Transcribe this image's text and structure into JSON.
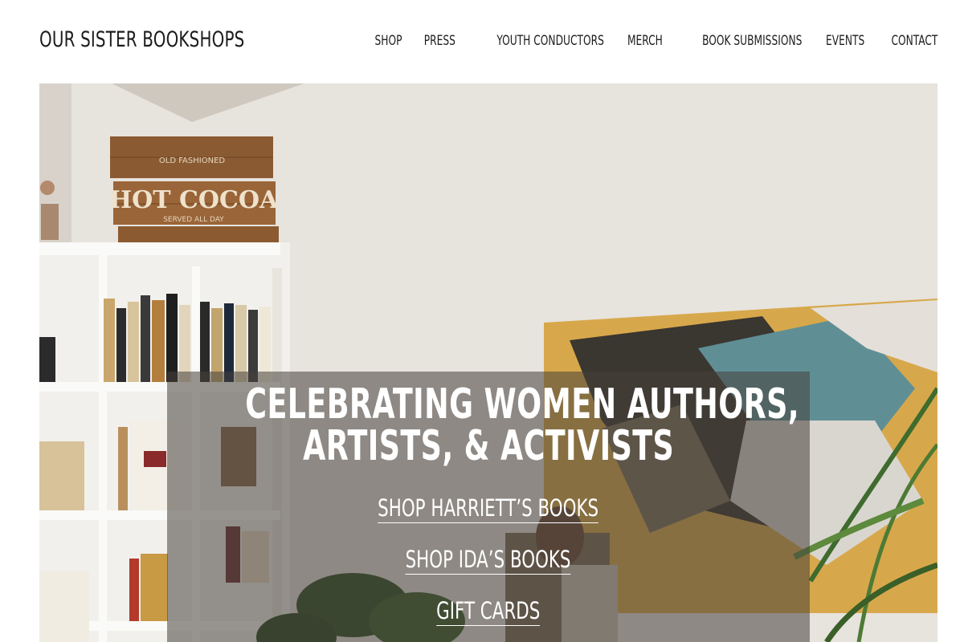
{
  "site": {
    "brand": "OUR SISTER BOOKSHOPS"
  },
  "nav": {
    "items": [
      "SHOP",
      "PRESS",
      "YOUTH CONDUCTORS",
      "MERCH",
      "BOOK SUBMISSIONS",
      "EVENTS",
      "CONTACT"
    ]
  },
  "hero": {
    "headline_line1": "CELEBRATING WOMEN AUTHORS,",
    "headline_line2": "ARTISTS, & ACTIVISTS",
    "links": [
      "SHOP HARRIETT’S BOOKS",
      "SHOP IDA’S BOOKS",
      "GIFT CARDS"
    ],
    "sign_text_top": "OLD FASHIONED",
    "sign_text_main": "HOT COCOA",
    "sign_text_sub": "SERVED ALL DAY"
  },
  "colors": {
    "text": "#1c1c1c",
    "background": "#ffffff",
    "overlay": "#46403a",
    "overlay_text": "#ffffff"
  }
}
